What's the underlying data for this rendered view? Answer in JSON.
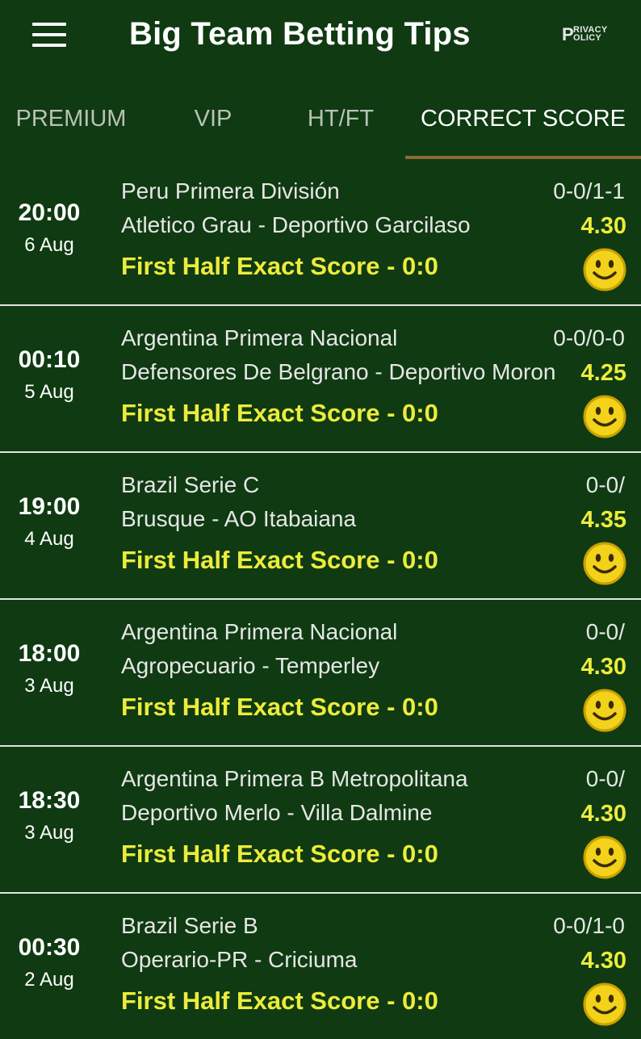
{
  "header": {
    "title": "Big Team Betting Tips",
    "privacy_big": "P",
    "privacy_line1": "RIVACY",
    "privacy_line2": "OLICY"
  },
  "tabs": [
    {
      "label": "PREMIUM",
      "active": false
    },
    {
      "label": "VIP",
      "active": false
    },
    {
      "label": "HT/FT",
      "active": false
    },
    {
      "label": "CORRECT SCORE",
      "active": true
    }
  ],
  "colors": {
    "background": "#0f3a12",
    "tip_text": "#ecec3c",
    "tab_indicator": "#8a6a35",
    "result_icon": "#f2d21a"
  },
  "result_icon_name": "smiley-win-icon",
  "tips": [
    {
      "time": "20:00",
      "date": "6 Aug",
      "league": "Peru Primera División",
      "match": "Atletico Grau - Deportivo Garcilaso",
      "score": "0-0/1-1",
      "odds": "4.30",
      "tip": "First Half Exact Score - 0:0"
    },
    {
      "time": "00:10",
      "date": "5 Aug",
      "league": "Argentina Primera Nacional",
      "match": "Defensores De Belgrano - Deportivo Moron",
      "score": "0-0/0-0",
      "odds": "4.25",
      "tip": "First Half Exact Score - 0:0"
    },
    {
      "time": "19:00",
      "date": "4 Aug",
      "league": "Brazil Serie C",
      "match": "Brusque - AO Itabaiana",
      "score": "0-0/",
      "odds": "4.35",
      "tip": "First Half Exact Score - 0:0"
    },
    {
      "time": "18:00",
      "date": "3 Aug",
      "league": "Argentina Primera Nacional",
      "match": "Agropecuario - Temperley",
      "score": "0-0/",
      "odds": "4.30",
      "tip": "First Half Exact Score - 0:0"
    },
    {
      "time": "18:30",
      "date": "3 Aug",
      "league": "Argentina Primera B Metropolitana",
      "match": "Deportivo Merlo - Villa Dalmine",
      "score": "0-0/",
      "odds": "4.30",
      "tip": "First Half Exact Score - 0:0"
    },
    {
      "time": "00:30",
      "date": "2 Aug",
      "league": "Brazil Serie B",
      "match": "Operario-PR - Criciuma",
      "score": "0-0/1-0",
      "odds": "4.30",
      "tip": "First Half Exact Score - 0:0"
    }
  ]
}
